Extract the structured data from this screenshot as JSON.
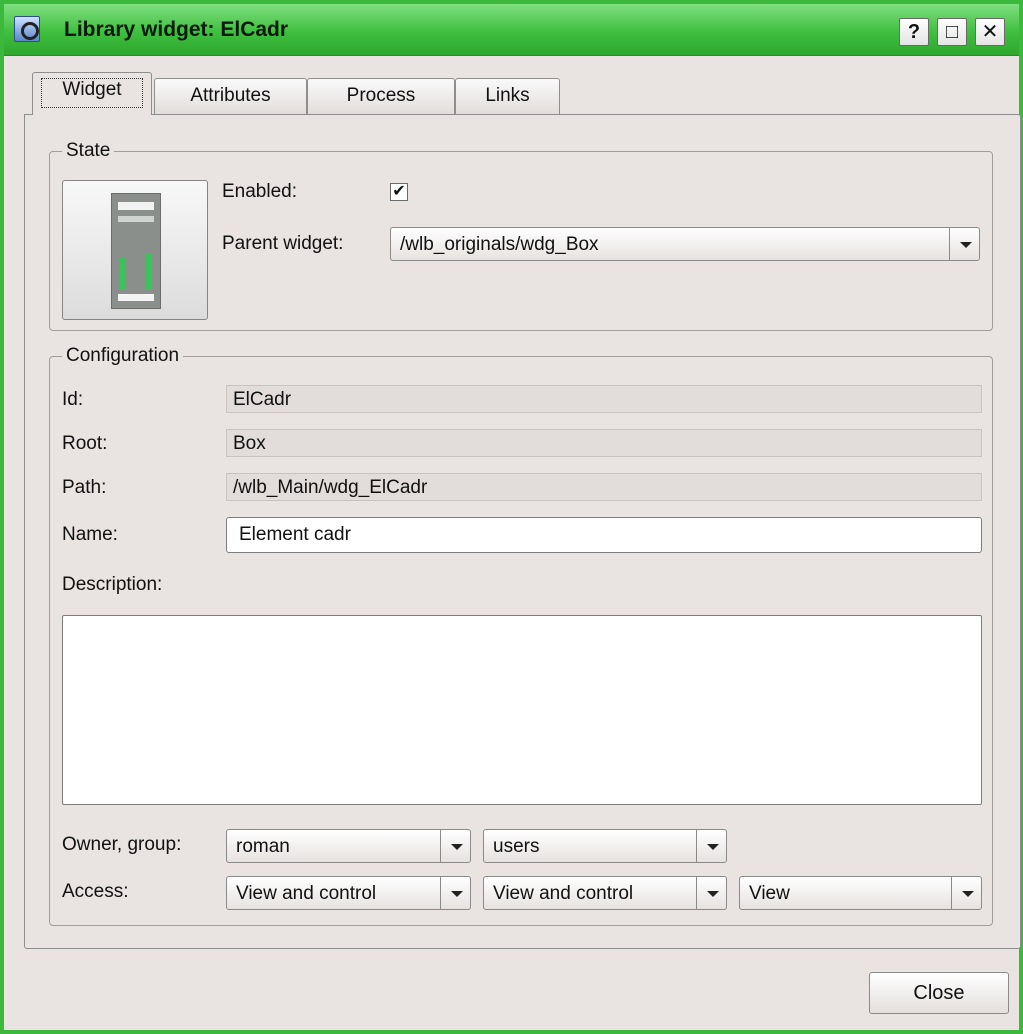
{
  "window": {
    "title": "Library widget: ElCadr",
    "help_glyph": "?",
    "maximize_glyph": "□",
    "close_glyph": "✕"
  },
  "tabs": [
    {
      "label": "Widget",
      "active": true
    },
    {
      "label": "Attributes",
      "active": false
    },
    {
      "label": "Process",
      "active": false
    },
    {
      "label": "Links",
      "active": false
    }
  ],
  "state": {
    "legend": "State",
    "enabled_label": "Enabled:",
    "enabled_checked": true,
    "check_glyph": "✔",
    "parent_label": "Parent widget:",
    "parent_value": "/wlb_originals/wdg_Box"
  },
  "config": {
    "legend": "Configuration",
    "id_label": "Id:",
    "id_value": "ElCadr",
    "root_label": "Root:",
    "root_value": "Box",
    "path_label": "Path:",
    "path_value": "/wlb_Main/wdg_ElCadr",
    "name_label": "Name:",
    "name_value": "Element cadr",
    "description_label": "Description:",
    "description_value": "",
    "owner_label": "Owner, group:",
    "owner_value": "roman",
    "group_value": "users",
    "access_label": "Access:",
    "access_owner": "View and control",
    "access_group": "View and control",
    "access_other": "View"
  },
  "footer": {
    "close_label": "Close"
  },
  "colors": {
    "titlebar": "#3fbf3f",
    "window_bg": "#e9e3e1"
  },
  "icons": {
    "app": "magnifier-window-icon",
    "combo_arrow": "chevron-down-icon"
  }
}
